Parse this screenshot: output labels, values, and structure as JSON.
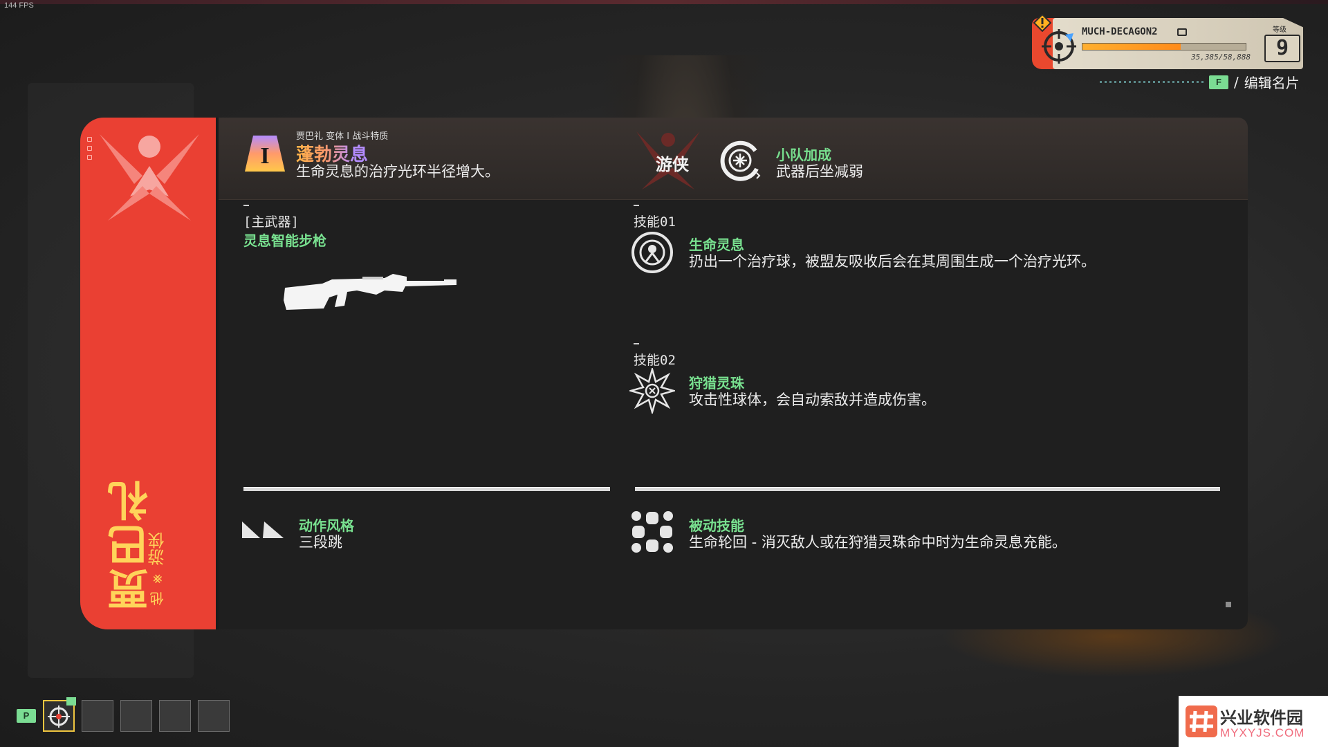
{
  "hud": {
    "fps": "144 FPS"
  },
  "hero": {
    "name": "贾巴礼",
    "pronoun": "他",
    "class_icon_glyph": "⨳",
    "class": "游侠",
    "accent_color": "#ea4033",
    "name_color": "#ffd45a"
  },
  "variant": {
    "small_label": "贾巴礼 变体 I 战斗特质",
    "badge": "I",
    "title": "蓬勃灵息",
    "description": "生命灵息的治疗光环半径增大。"
  },
  "class_tag": {
    "label": "游侠"
  },
  "squad_bonus": {
    "title": "小队加成",
    "description": "武器后坐减弱"
  },
  "primary_weapon": {
    "section_label": "[主武器]",
    "name": "灵息智能步枪"
  },
  "ability1": {
    "section_label": "技能01",
    "title": "生命灵息",
    "description": "扔出一个治疗球，被盟友吸收后会在其周围生成一个治疗光环。"
  },
  "ability2": {
    "section_label": "技能02",
    "title": "狩猎灵珠",
    "description": "攻击性球体，会自动索敌并造成伤害。"
  },
  "movement": {
    "title": "动作风格",
    "description": "三段跳"
  },
  "passive": {
    "title": "被动技能",
    "description": "生命轮回 - 消灭敌人或在狩猎灵珠命中时为生命灵息充能。"
  },
  "profile": {
    "player_name": "MUCH-DECAGON2",
    "xp_text": "35,385/58,888",
    "xp_progress": 0.6,
    "level_label": "等级",
    "level": "9",
    "edit_key": "F",
    "edit_sep": "/",
    "edit_label": "编辑名片"
  },
  "loadout": {
    "key": "P",
    "slots": 5,
    "active_slot": 0
  },
  "watermark": {
    "title": "兴业软件园",
    "url": "MYXYJS.COM"
  }
}
